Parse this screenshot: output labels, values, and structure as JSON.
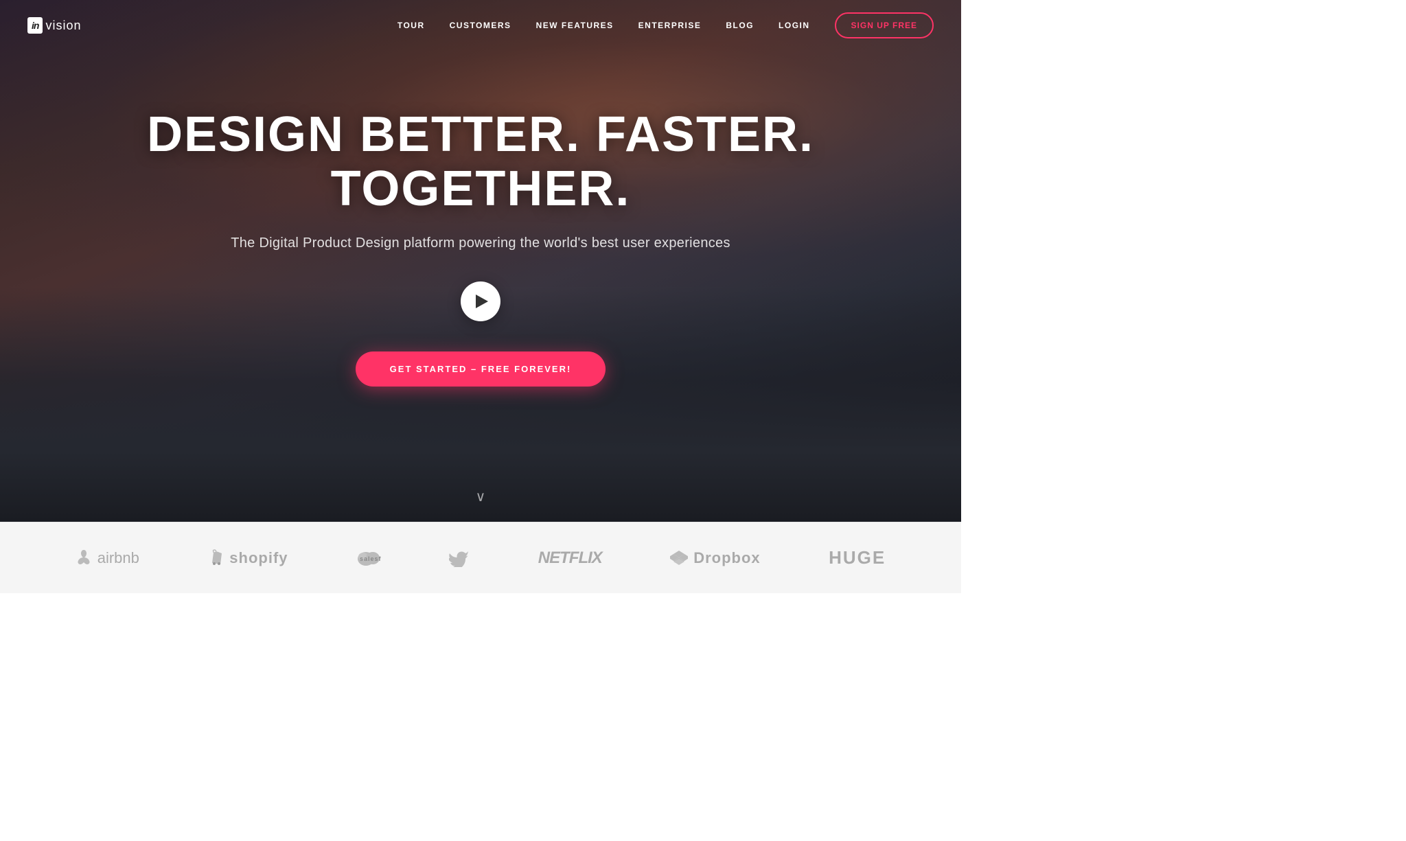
{
  "header": {
    "logo": {
      "in_text": "in",
      "vision_text": "vision"
    },
    "nav": {
      "items": [
        {
          "id": "tour",
          "label": "TOUR"
        },
        {
          "id": "customers",
          "label": "CUSTOMERS"
        },
        {
          "id": "new-features",
          "label": "NEW FEATURES"
        },
        {
          "id": "enterprise",
          "label": "ENTERPRISE"
        },
        {
          "id": "blog",
          "label": "BLOG"
        },
        {
          "id": "login",
          "label": "LOGIN"
        }
      ],
      "signup_label": "SIGN UP FREE"
    }
  },
  "hero": {
    "title": "DESIGN BETTER. FASTER. TOGETHER.",
    "subtitle": "The Digital Product Design platform powering the world's best user experiences",
    "cta_label": "GET STARTED – FREE FOREVER!",
    "play_button_label": "Play video",
    "scroll_arrow": "∨"
  },
  "logos_bar": {
    "brands": [
      {
        "id": "airbnb",
        "name": "airbnb",
        "icon": "airbnb"
      },
      {
        "id": "shopify",
        "name": "shopify",
        "icon": "shopify"
      },
      {
        "id": "salesforce",
        "name": "salesforce",
        "icon": "salesforce"
      },
      {
        "id": "twitter",
        "name": "",
        "icon": "twitter"
      },
      {
        "id": "netflix",
        "name": "NETFLIX",
        "icon": ""
      },
      {
        "id": "dropbox",
        "name": "Dropbox",
        "icon": "dropbox"
      },
      {
        "id": "huge",
        "name": "HUGE",
        "icon": ""
      }
    ]
  }
}
